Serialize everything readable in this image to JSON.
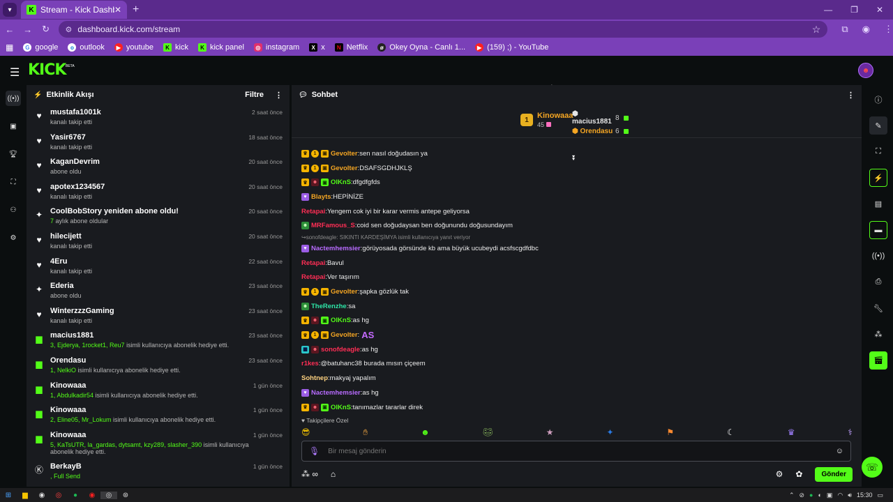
{
  "browser": {
    "tab_title": "Stream - Kick Dashboard",
    "url": "dashboard.kick.com/stream",
    "bookmarks": [
      {
        "label": "google",
        "color": "#ffffff"
      },
      {
        "label": "outlook",
        "color": "#ffffff"
      },
      {
        "label": "youtube",
        "color": "#ff2020"
      },
      {
        "label": "kick",
        "color": "#53fc18"
      },
      {
        "label": "kick panel",
        "color": "#53fc18"
      },
      {
        "label": "instagram",
        "color": "#e1306c"
      },
      {
        "label": "x",
        "color": "#000000"
      },
      {
        "label": "Netflix",
        "color": "#e50914"
      },
      {
        "label": "Okey Oyna - Canlı 1...",
        "color": "#222222"
      },
      {
        "label": "(159) ;) - YouTube",
        "color": "#ff2020"
      }
    ]
  },
  "header": {
    "logo": "KICK",
    "beta": "BETA"
  },
  "activity": {
    "title": "Etkinlik Akışı",
    "filter": "Filtre",
    "events": [
      {
        "icon": "heart",
        "name": "mustafa1001k",
        "sub": "kanalı takip etti",
        "time": "2 saat önce"
      },
      {
        "icon": "heart",
        "name": "Yasir6767",
        "sub": "kanalı takip etti",
        "time": "18 saat önce"
      },
      {
        "icon": "heart",
        "name": "KaganDevrim",
        "sub": "abone oldu",
        "time": "20 saat önce"
      },
      {
        "icon": "heart",
        "name": "apotex1234567",
        "sub": "kanalı takip etti",
        "time": "20 saat önce"
      },
      {
        "icon": "spark",
        "name": "CoolBobStory yeniden abone oldu!",
        "sub_green": "7",
        "sub": " aylık abone oldular",
        "time": "20 saat önce"
      },
      {
        "icon": "heart",
        "name": "hilecijett",
        "sub": "kanalı takip etti",
        "time": "20 saat önce"
      },
      {
        "icon": "heart",
        "name": "4Eru",
        "sub": "kanalı takip etti",
        "time": "22 saat önce"
      },
      {
        "icon": "spark",
        "name": "Ederia",
        "sub": "abone oldu",
        "time": "23 saat önce"
      },
      {
        "icon": "heart",
        "name": "WinterzzzGaming",
        "sub": "kanalı takip etti",
        "time": "23 saat önce"
      },
      {
        "icon": "gift",
        "name": "macius1881",
        "sub_green": "3, Ejderya, 1rocket1, Reu7",
        "sub": " isimli kullanıcıya abonelik hediye etti.",
        "time": "23 saat önce"
      },
      {
        "icon": "gift",
        "name": "Orendasu",
        "sub_green": "1, NelkiO",
        "sub": " isimli kullanıcıya abonelik hediye etti.",
        "time": "23 saat önce"
      },
      {
        "icon": "gift",
        "name": "Kinowaaa",
        "sub_green": "1, Abdulkadir54",
        "sub": " isimli kullanıcıya abonelik hediye etti.",
        "time": "1 gün önce"
      },
      {
        "icon": "gift",
        "name": "Kinowaaa",
        "sub_green": "2, Eline05, Mr_Lokum",
        "sub": " isimli kullanıcıya abonelik hediye etti.",
        "time": "1 gün önce"
      },
      {
        "icon": "gift",
        "name": "Kinowaaa",
        "sub_green": "5, KaTsUTR, la_gardas, dytsamt, kzy289, slasher_390",
        "sub": " isimli kullanıcıya abonelik hediye etti.",
        "time": "1 gün önce"
      },
      {
        "icon": "kick",
        "name": "BerkayB",
        "sub_green": ", Full Send",
        "sub": "",
        "time": "1 gün önce"
      }
    ]
  },
  "chat": {
    "title": "Sohbet",
    "top1": {
      "name": "Kinowaaa",
      "count": "45",
      "rank": "1"
    },
    "top2": [
      {
        "name": "macius1881",
        "count": "8",
        "color": "#e6e6e6"
      },
      {
        "name": "Orendasu",
        "count": "6",
        "color": "#f5a623"
      }
    ],
    "messages": [
      {
        "badges": [
          "crown",
          "one",
          "box"
        ],
        "user": "Gevolter",
        "color": "#f5a623",
        "text": "sen nasıl doğudasın ya"
      },
      {
        "badges": [
          "crown",
          "one",
          "box"
        ],
        "user": "Gevolter",
        "color": "#f5a623",
        "text": "DSAFSGDHJKLŞ"
      },
      {
        "badges": [
          "crown",
          "red",
          "grn"
        ],
        "user": "OlKnS",
        "color": "#53fc18",
        "text": "dfgdfgfds"
      },
      {
        "badges": [
          "pur"
        ],
        "user": "Blayts",
        "color": "#f5a623",
        "text": "HEPİNİZE"
      },
      {
        "badges": [],
        "user": "Retapai",
        "color": "#ff2e55",
        "text": "Yengem cok iyi bir karar vermis antepe geliyorsa"
      },
      {
        "badges": [
          "frog"
        ],
        "user": "MRFamous_S",
        "color": "#ff2e55",
        "text": "coid sen doğudaysan ben doğunundu doğusundayım"
      },
      {
        "reply": "sonofdeagle: SIKINTI KARDEŞİMYA isimli kullanıcıya yanıt veriyor"
      },
      {
        "badges": [
          "pur"
        ],
        "user": "Nactemhemsier",
        "color": "#b86bff",
        "text": "görüyosada görsünde kb ama büyük ucubeydi acsfscgdfdbc"
      },
      {
        "badges": [],
        "user": "Retapai",
        "color": "#ff2e55",
        "text": "Bavul"
      },
      {
        "badges": [],
        "user": "Retapai",
        "color": "#ff2e55",
        "text": "Ver taşırım"
      },
      {
        "badges": [
          "crown",
          "one",
          "box"
        ],
        "user": "Gevolter",
        "color": "#f5a623",
        "text": "şapka gözlük tak"
      },
      {
        "badges": [
          "frog"
        ],
        "user": "TheRenzhe",
        "color": "#2ee6a8",
        "text": "sa"
      },
      {
        "badges": [
          "crown",
          "red",
          "grn"
        ],
        "user": "OlKnS",
        "color": "#53fc18",
        "text": "as hg"
      },
      {
        "badges": [
          "crown",
          "one",
          "box"
        ],
        "user": "Gevolter",
        "color": "#f5a623",
        "text": "",
        "emote": "AS"
      },
      {
        "badges": [
          "cy",
          "red"
        ],
        "user": "sonofdeagle",
        "color": "#ff2e55",
        "text": "as hg"
      },
      {
        "badges": [],
        "user": "r1kes",
        "color": "#ff2e55",
        "text": "@batuhanc38 burada mısın çiçeem"
      },
      {
        "badges": [],
        "user": "Sohtnep",
        "color": "#ffd280",
        "text": "makyaj yapalım"
      },
      {
        "badges": [
          "pur"
        ],
        "user": "Nactemhemsier",
        "color": "#b86bff",
        "text": "as hg"
      },
      {
        "badges": [
          "crown",
          "red",
          "grn"
        ],
        "user": "OlKnS",
        "color": "#53fc18",
        "text": "tanımazlar tararlar direk"
      }
    ],
    "followers_only": "Takipçilere Özel",
    "input_placeholder": "Bir mesaj gönderin",
    "send": "Gönder"
  },
  "taskbar": {
    "time": "15:30"
  }
}
